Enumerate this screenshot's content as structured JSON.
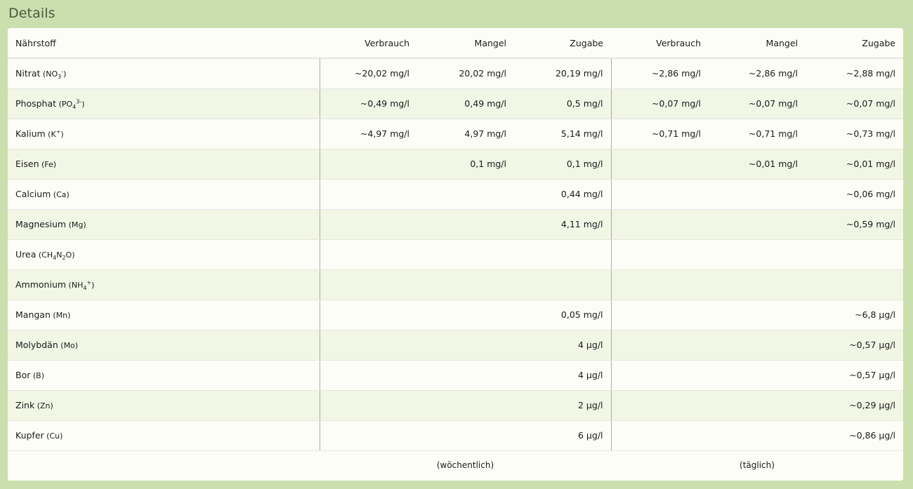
{
  "title": "Details",
  "headers": [
    "Nährstoff",
    "Verbrauch",
    "Mangel",
    "Zugabe",
    "Verbrauch",
    "Mangel",
    "Zugabe"
  ],
  "rows": [
    {
      "name": "Nitrat",
      "formula": [
        [
          "t",
          "NO"
        ],
        [
          "sub",
          "3"
        ],
        [
          "sup",
          "-"
        ]
      ],
      "values": [
        "~20,02 mg/l",
        "20,02 mg/l",
        "20,19 mg/l",
        "~2,86 mg/l",
        "~2,86 mg/l",
        "~2,88 mg/l"
      ]
    },
    {
      "name": "Phosphat",
      "formula": [
        [
          "t",
          "PO"
        ],
        [
          "sub",
          "4"
        ],
        [
          "sup",
          "3-"
        ]
      ],
      "values": [
        "~0,49 mg/l",
        "0,49 mg/l",
        "0,5 mg/l",
        "~0,07 mg/l",
        "~0,07 mg/l",
        "~0,07 mg/l"
      ]
    },
    {
      "name": "Kalium",
      "formula": [
        [
          "t",
          "K"
        ],
        [
          "sup",
          "+"
        ]
      ],
      "values": [
        "~4,97 mg/l",
        "4,97 mg/l",
        "5,14 mg/l",
        "~0,71 mg/l",
        "~0,71 mg/l",
        "~0,73 mg/l"
      ]
    },
    {
      "name": "Eisen",
      "formula": [
        [
          "t",
          "Fe"
        ]
      ],
      "values": [
        "",
        "0,1 mg/l",
        "0,1 mg/l",
        "",
        "~0,01 mg/l",
        "~0,01 mg/l"
      ]
    },
    {
      "name": "Calcium",
      "formula": [
        [
          "t",
          "Ca"
        ]
      ],
      "values": [
        "",
        "",
        "0,44 mg/l",
        "",
        "",
        "~0,06 mg/l"
      ]
    },
    {
      "name": "Magnesium",
      "formula": [
        [
          "t",
          "Mg"
        ]
      ],
      "values": [
        "",
        "",
        "4,11 mg/l",
        "",
        "",
        "~0,59 mg/l"
      ]
    },
    {
      "name": "Urea",
      "formula": [
        [
          "t",
          "CH"
        ],
        [
          "sub",
          "4"
        ],
        [
          "t",
          "N"
        ],
        [
          "sub",
          "2"
        ],
        [
          "t",
          "O"
        ]
      ],
      "values": [
        "",
        "",
        "",
        "",
        "",
        ""
      ]
    },
    {
      "name": "Ammonium",
      "formula": [
        [
          "t",
          "NH"
        ],
        [
          "sub",
          "4"
        ],
        [
          "sup",
          "+"
        ]
      ],
      "values": [
        "",
        "",
        "",
        "",
        "",
        ""
      ]
    },
    {
      "name": "Mangan",
      "formula": [
        [
          "t",
          "Mn"
        ]
      ],
      "values": [
        "",
        "",
        "0,05 mg/l",
        "",
        "",
        "~6,8 µg/l"
      ]
    },
    {
      "name": "Molybdän",
      "formula": [
        [
          "t",
          "Mo"
        ]
      ],
      "values": [
        "",
        "",
        "4 µg/l",
        "",
        "",
        "~0,57 µg/l"
      ]
    },
    {
      "name": "Bor",
      "formula": [
        [
          "t",
          "B"
        ]
      ],
      "values": [
        "",
        "",
        "4 µg/l",
        "",
        "",
        "~0,57 µg/l"
      ]
    },
    {
      "name": "Zink",
      "formula": [
        [
          "t",
          "Zn"
        ]
      ],
      "values": [
        "",
        "",
        "2 µg/l",
        "",
        "",
        "~0,29 µg/l"
      ]
    },
    {
      "name": "Kupfer",
      "formula": [
        [
          "t",
          "Cu"
        ]
      ],
      "values": [
        "",
        "",
        "6 µg/l",
        "",
        "",
        "~0,86 µg/l"
      ]
    }
  ],
  "footer": {
    "weekly": "(wöchentlich)",
    "daily": "(täglich)"
  }
}
